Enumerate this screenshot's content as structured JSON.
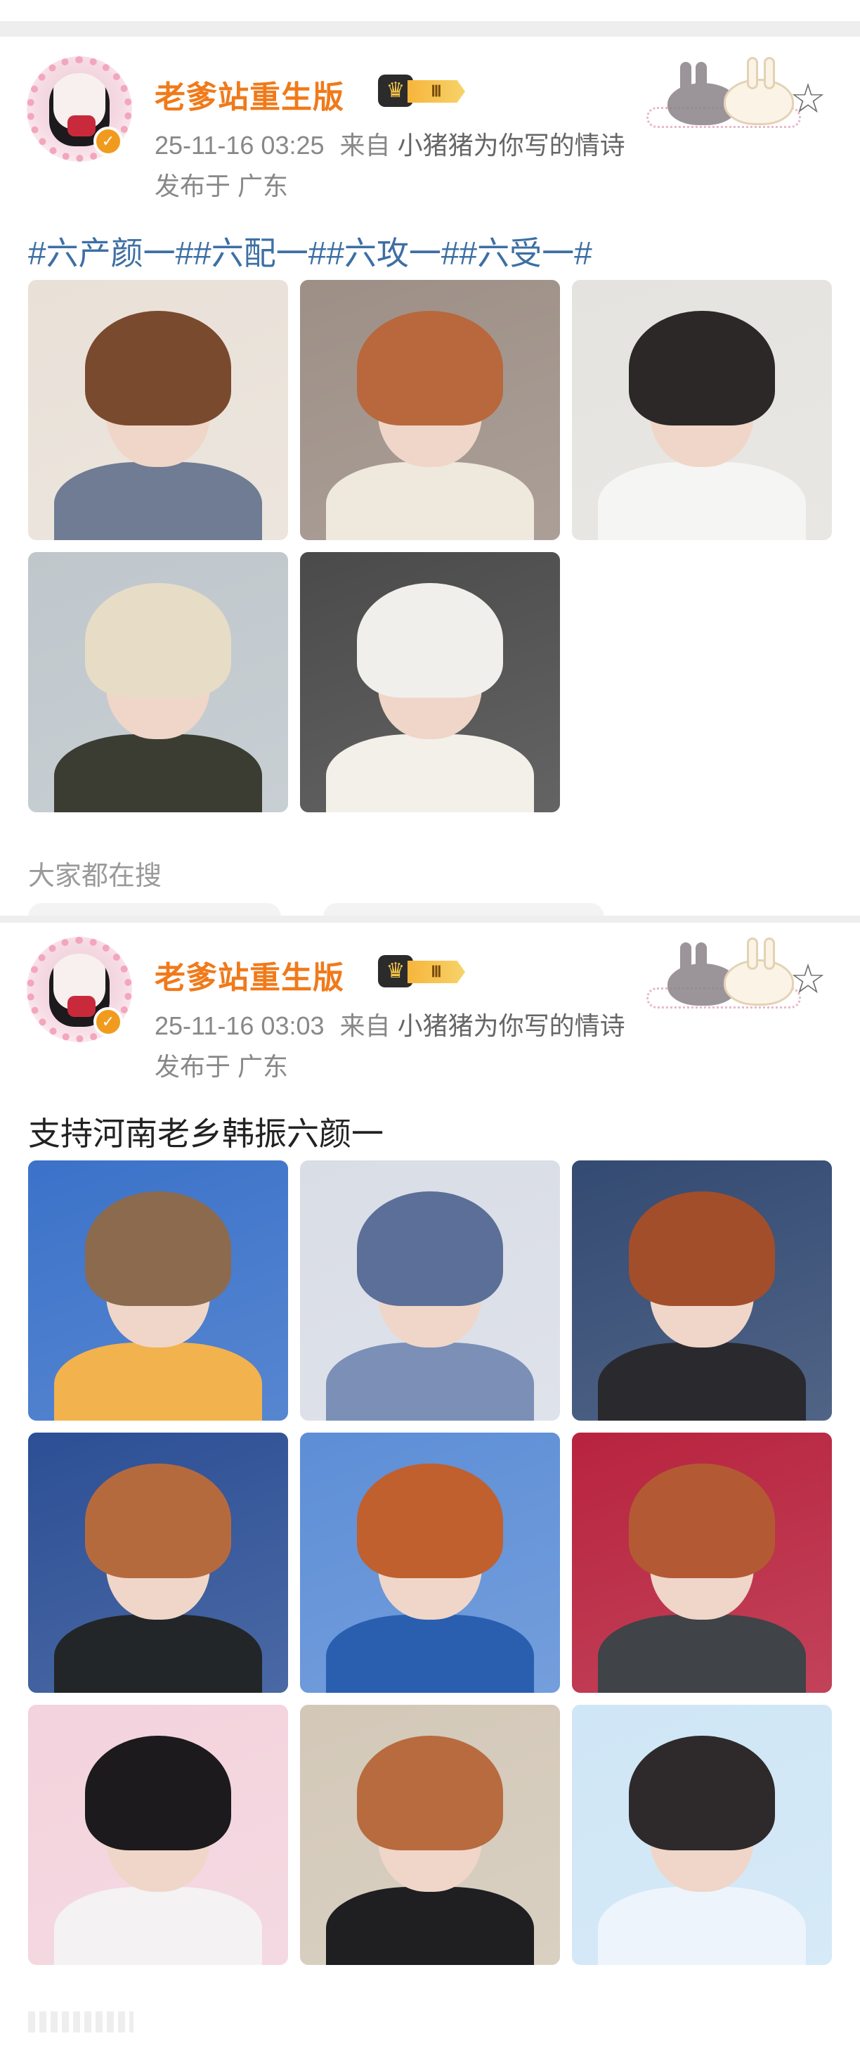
{
  "posts": [
    {
      "username": "老爹站重生版",
      "level": "Ⅲ",
      "time": "25-11-16 03:25",
      "from_prefix": "来自",
      "source": "小猪猪为你写的情诗",
      "location": "发布于 广东",
      "text": "#六产颜一##六配一##六攻一##六受一#",
      "image_count": 5,
      "images": [
        {
          "hair": "#7a4a2e",
          "bg": "#e9e1d8",
          "body": "#6f7c93"
        },
        {
          "hair": "#b8683c",
          "bg": "#9d8f86",
          "body": "#efe8dc"
        },
        {
          "hair": "#2b2827",
          "bg": "#e5e3df",
          "body": "#f5f5f3"
        },
        {
          "hair": "#e7dcc6",
          "bg": "#bfc7cc",
          "body": "#3b3d33"
        },
        {
          "hair": "#f1efec",
          "bg": "#4a4a4a",
          "body": "#f3f0ea"
        }
      ],
      "search_label": "大家都在搜"
    },
    {
      "username": "老爹站重生版",
      "level": "Ⅲ",
      "time": "25-11-16 03:03",
      "from_prefix": "来自",
      "source": "小猪猪为你写的情诗",
      "location": "发布于 广东",
      "text": "支持河南老乡韩振六颜一",
      "image_count": 9,
      "images": [
        {
          "hair": "#8c6a4e",
          "bg": "#3b72c9",
          "body": "#f2b24e"
        },
        {
          "hair": "#5b6f98",
          "bg": "#d9dde6",
          "body": "#7b8fb7"
        },
        {
          "hair": "#a24e2b",
          "bg": "#334a72",
          "body": "#2a2a2e"
        },
        {
          "hair": "#b56a3e",
          "bg": "#2c4f95",
          "body": "#232628"
        },
        {
          "hair": "#c0602e",
          "bg": "#5d8ed6",
          "body": "#2a5fb0"
        },
        {
          "hair": "#b35a34",
          "bg": "#b8233e",
          "body": "#404347"
        },
        {
          "hair": "#1c1a1c",
          "bg": "#f3d3dd",
          "body": "#f4f2f2"
        },
        {
          "hair": "#b86b3e",
          "bg": "#d3c8b8",
          "body": "#1f1f22"
        },
        {
          "hair": "#2e2a2c",
          "bg": "#cfe6f6",
          "body": "#eef4fb"
        }
      ]
    }
  ],
  "icons": {
    "favorite": "star-outline-icon",
    "verified": "verified-check-icon",
    "level_crown": "crown-icon"
  }
}
